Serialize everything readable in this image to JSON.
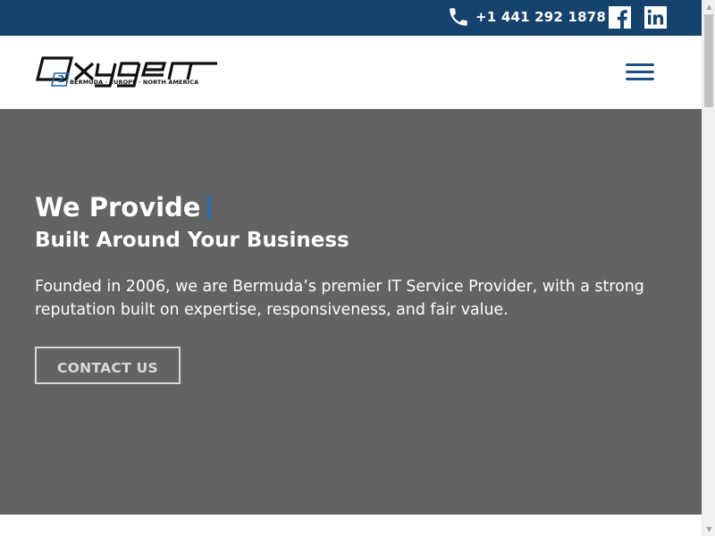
{
  "topbar": {
    "phone": "+1 441 292 1878",
    "phone_icon": "phone-icon",
    "social": [
      "facebook-icon",
      "linkedin-icon"
    ],
    "background": "#16426e"
  },
  "header": {
    "logo": {
      "word": "OXYGEN",
      "badge": "2",
      "tagline": "BERMUDA · EUROPE · NORTH AMERICA"
    },
    "menu_icon": "hamburger-menu-icon"
  },
  "hero": {
    "title": "We Provide",
    "subtitle": "Built Around Your Business",
    "text": "Founded in 2006, we are Bermuda’s premier IT Service Provider, with a strong reputation built on expertise, responsiveness, and fair value.",
    "button": "CONTACT US",
    "background": "#636363",
    "accent": "#2f6db5"
  }
}
